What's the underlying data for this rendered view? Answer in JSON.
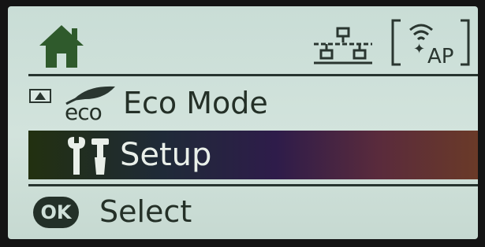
{
  "status_bar": {
    "home_icon": "home-icon",
    "network_icon": "wired-network-icon",
    "ap_icon": {
      "name": "wifi-ap-icon",
      "label": "AP"
    }
  },
  "menu": {
    "items": [
      {
        "icon": "eco-leaf-icon",
        "icon_text": "eco",
        "label": "Eco Mode",
        "selected": false
      },
      {
        "icon": "wrench-screwdriver-icon",
        "label": "Setup",
        "selected": true
      }
    ],
    "scroll_indicator": "scroll-up-arrow-icon"
  },
  "footer": {
    "ok_label": "OK",
    "action_label": "Select"
  },
  "colors": {
    "lcd_background": "#cfe1da",
    "foreground": "#243027",
    "highlight_start": "#223010",
    "highlight_end": "#6a3a28"
  }
}
